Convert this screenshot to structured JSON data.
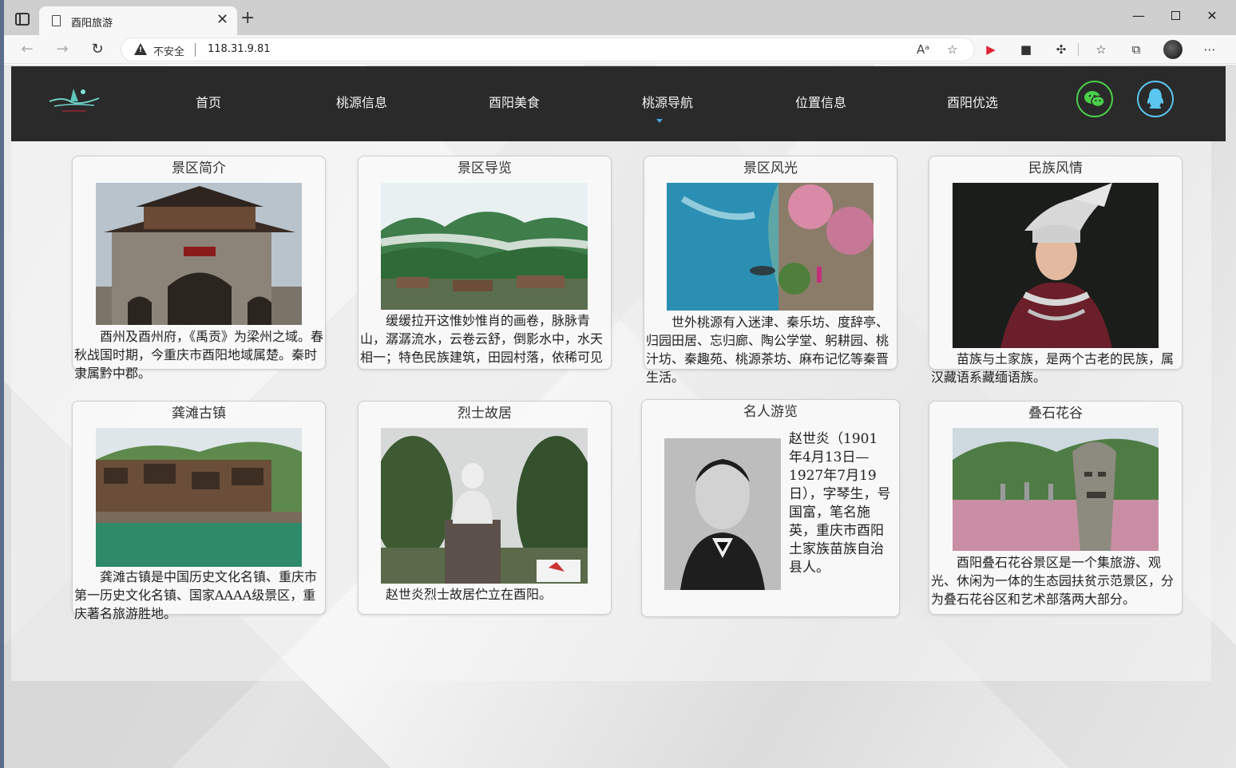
{
  "browser": {
    "tab_title": "酉阳旅游",
    "insecure_label": "不安全",
    "url": "118.31.9.81",
    "close_tab": "✕",
    "new_tab": "+",
    "minimize": "—",
    "close_window": "✕",
    "more": "⋯"
  },
  "nav": {
    "items": [
      {
        "label": "首页"
      },
      {
        "label": "桃源信息"
      },
      {
        "label": "酉阳美食"
      },
      {
        "label": "桃源导航"
      },
      {
        "label": "位置信息"
      },
      {
        "label": "酉阳优选"
      }
    ],
    "active": "桃源导航"
  },
  "cards": [
    {
      "title": "景区简介",
      "text": "酉州及酉州府，《禹贡》为梁州之域。春秋战国时期，今重庆市酉阳地域属楚。秦时隶属黔中郡。"
    },
    {
      "title": "景区导览",
      "text": "缓缓拉开这惟妙惟肖的画卷，脉脉青山，潺潺流水，云卷云舒，倒影水中，水天相一；特色民族建筑，田园村落，依稀可见"
    },
    {
      "title": "景区风光",
      "text": "世外桃源有入迷津、秦乐坊、度辞亭、归园田居、忘归廊、陶公学堂、躬耕园、桃汁坊、秦趣苑、桃源茶坊、麻布记忆等秦晋生活。"
    },
    {
      "title": "民族风情",
      "text": "苗族与土家族，是两个古老的民族，属汉藏语系藏缅语族。"
    },
    {
      "title": "龚滩古镇",
      "text": "龚滩古镇是中国历史文化名镇、重庆市第一历史文化名镇、国家AAAA级景区，重庆著名旅游胜地。"
    },
    {
      "title": "烈士故居",
      "text": "赵世炎烈士故居伫立在酉阳。"
    },
    {
      "title": "名人游览",
      "text": "赵世炎（1901年4月13日—1927年7月19日），字琴生，号国富，笔名施英，重庆市酉阳土家族苗族自治县人。"
    },
    {
      "title": "叠石花谷",
      "text": "酉阳叠石花谷景区是一个集旅游、观光、休闲为一体的生态园扶贫示范景区，分为叠石花谷区和艺术部落两大部分。"
    }
  ],
  "colors": {
    "header_bg": "#2a2a2a",
    "nav_active_marker": "#4aa3df",
    "wechat_green": "#4ad04a",
    "qq_blue": "#5bc6ef"
  }
}
